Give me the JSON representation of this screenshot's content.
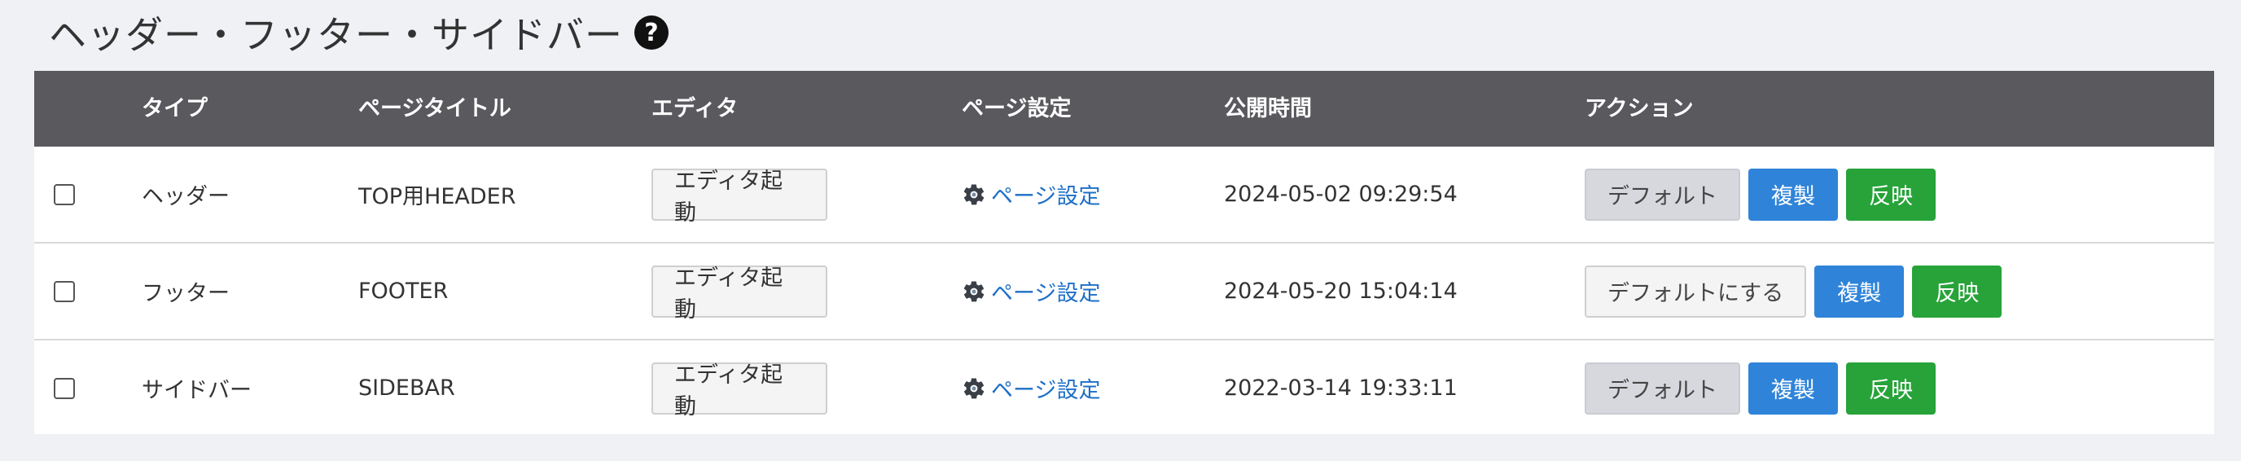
{
  "page": {
    "title": "ヘッダー・フッター・サイドバー",
    "help_icon": "?"
  },
  "table": {
    "headers": {
      "type": "タイプ",
      "page_title": "ページタイトル",
      "editor": "エディタ",
      "page_settings": "ページ設定",
      "publish_time": "公開時間",
      "actions": "アクション"
    },
    "rows": [
      {
        "type": "ヘッダー",
        "page_title": "TOP用HEADER",
        "editor_button": "エディタ起動",
        "settings_link": "ページ設定",
        "publish_time": "2024-05-02 09:29:54",
        "default_button": "デフォルト",
        "duplicate_button": "複製",
        "apply_button": "反映"
      },
      {
        "type": "フッター",
        "page_title": "FOOTER",
        "editor_button": "エディタ起動",
        "settings_link": "ページ設定",
        "publish_time": "2024-05-20 15:04:14",
        "default_button": "デフォルトにする",
        "duplicate_button": "複製",
        "apply_button": "反映"
      },
      {
        "type": "サイドバー",
        "page_title": "SIDEBAR",
        "editor_button": "エディタ起動",
        "settings_link": "ページ設定",
        "publish_time": "2022-03-14 19:33:11",
        "default_button": "デフォルト",
        "duplicate_button": "複製",
        "apply_button": "反映"
      }
    ]
  },
  "colors": {
    "header_bg": "#5a595e",
    "page_bg": "#f0f1f4",
    "blue": "#2f84d9",
    "green": "#27a339",
    "link": "#1e6fc7"
  },
  "icons": {
    "help": "question-circle-icon",
    "settings": "gear-icon",
    "checkbox": "checkbox-icon"
  }
}
